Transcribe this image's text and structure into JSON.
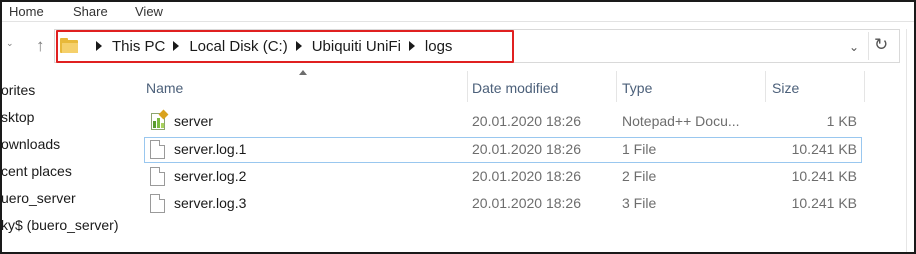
{
  "ribbon": {
    "tabs": [
      "Home",
      "Share",
      "View"
    ]
  },
  "nav_buttons": {
    "back": "←",
    "up": "↑",
    "dropdown": "⌄"
  },
  "address": {
    "crumbs": [
      "This PC",
      "Local Disk (C:)",
      "Ubiquiti UniFi",
      "logs"
    ],
    "dropdown_glyph": "⌄",
    "refresh_glyph": "↻"
  },
  "sidebar": {
    "items": [
      "orites",
      "sktop",
      "ownloads",
      "cent places",
      "uero_server",
      "ky$ (buero_server)"
    ]
  },
  "columns": {
    "name": "Name",
    "date": "Date modified",
    "type": "Type",
    "size": "Size"
  },
  "files": [
    {
      "name": "server",
      "date": "20.01.2020 18:26",
      "type": "Notepad++ Docu...",
      "size": "1 KB",
      "icon": "notepadpp-document-icon"
    },
    {
      "name": "server.log.1",
      "date": "20.01.2020 18:26",
      "type": "1 File",
      "size": "10.241 KB",
      "icon": "file-icon",
      "selected": true
    },
    {
      "name": "server.log.2",
      "date": "20.01.2020 18:26",
      "type": "2 File",
      "size": "10.241 KB",
      "icon": "file-icon"
    },
    {
      "name": "server.log.3",
      "date": "20.01.2020 18:26",
      "type": "3 File",
      "size": "10.241 KB",
      "icon": "file-icon"
    }
  ],
  "colors": {
    "highlight_border": "#e02020",
    "selection_border": "#99c7ef",
    "folder": "#e8b93a"
  }
}
